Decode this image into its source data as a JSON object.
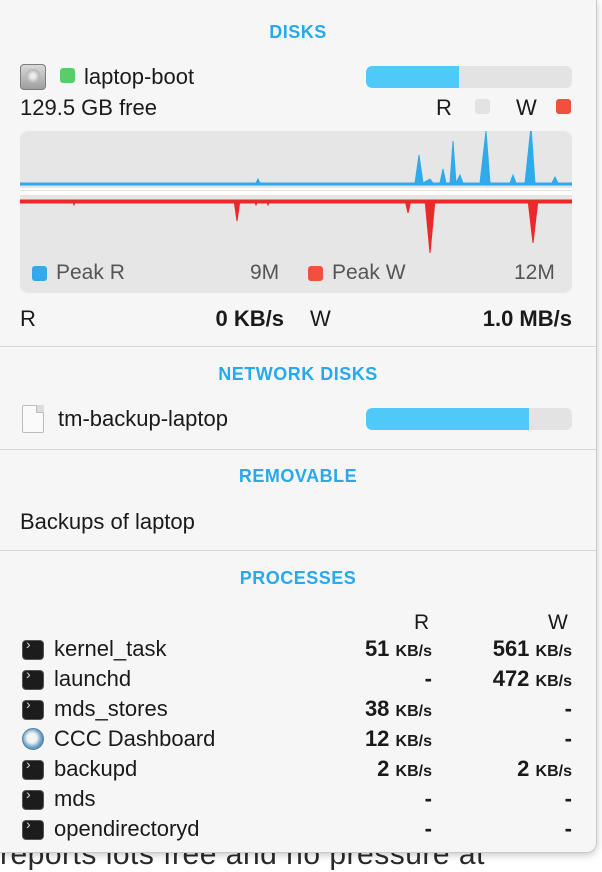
{
  "sections": {
    "disks": "DISKS",
    "network": "NETWORK DISKS",
    "removable": "REMOVABLE",
    "processes": "PROCESSES"
  },
  "disk": {
    "name": "laptop-boot",
    "free": "129.5 GB free",
    "usage_fraction": 0.45,
    "read_label": "R",
    "write_label": "W",
    "status_color": "#5ccc68"
  },
  "graph": {
    "peak_r_label": "Peak R",
    "peak_r_value": "9M",
    "peak_w_label": "Peak W",
    "peak_w_value": "12M",
    "read_color": "#30aaea",
    "write_color": "#ea2a2a"
  },
  "rates": {
    "r_label": "R",
    "r_value": "0 KB/s",
    "w_label": "W",
    "w_value": "1.0 MB/s"
  },
  "network_disk": {
    "name": "tm-backup-laptop",
    "usage_fraction": 0.79
  },
  "removable": {
    "name": "Backups of laptop"
  },
  "processes": {
    "col_r": "R",
    "col_w": "W",
    "unit": "KB/s",
    "rows": [
      {
        "name": "kernel_task",
        "icon": "terminal-icon",
        "r": "51",
        "w": "561"
      },
      {
        "name": "launchd",
        "icon": "terminal-icon",
        "r": "-",
        "w": "472"
      },
      {
        "name": "mds_stores",
        "icon": "terminal-icon",
        "r": "38",
        "w": "-"
      },
      {
        "name": "CCC Dashboard",
        "icon": "ccc-dashboard-icon",
        "r": "12",
        "w": "-"
      },
      {
        "name": "backupd",
        "icon": "terminal-icon",
        "r": "2",
        "w": "2"
      },
      {
        "name": "mds",
        "icon": "terminal-icon",
        "r": "-",
        "w": "-"
      },
      {
        "name": "opendirectoryd",
        "icon": "terminal-icon",
        "r": "-",
        "w": "-"
      }
    ]
  },
  "background": {
    "text": "reports lots free and no pressure at"
  },
  "colors": {
    "accent": "#2aa8ec",
    "bar": "#4fcaf8",
    "read_square": "#e3e3e3",
    "write_square": "#f0503c"
  }
}
